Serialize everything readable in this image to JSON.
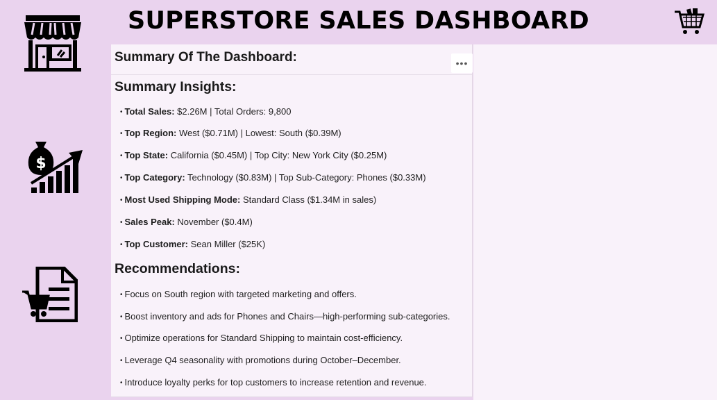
{
  "header": {
    "title": "SUPERSTORE SALES DASHBOARD"
  },
  "icons": {
    "store": "store-icon",
    "cart_top": "shopping-cart-icon",
    "money_growth": "money-growth-icon",
    "order_cart": "order-list-cart-icon"
  },
  "card": {
    "title": "Summary Of The Dashboard:",
    "more_label": "•••",
    "insights_title": "Summary Insights:",
    "insights": [
      {
        "label": "Total Sales:",
        "text": " $2.26M | Total Orders: 9,800"
      },
      {
        "label": "Top Region:",
        "text": " West ($0.71M) | Lowest: South ($0.39M)"
      },
      {
        "label": "Top State:",
        "text": " California ($0.45M) | Top City: New York City ($0.25M)"
      },
      {
        "label": "Top Category:",
        "text": " Technology ($0.83M) | Top Sub-Category: Phones ($0.33M)"
      },
      {
        "label": "Most Used Shipping Mode:",
        "text": " Standard Class ($1.34M in sales)"
      },
      {
        "label": "Sales Peak:",
        "text": " November ($0.4M)"
      },
      {
        "label": "Top Customer:",
        "text": " Sean Miller ($25K)"
      }
    ],
    "recommendations_title": "Recommendations:",
    "recommendations": [
      "Focus on South region with targeted marketing and offers.",
      "Boost inventory and ads for Phones and Chairs—high-performing sub-categories.",
      "Optimize operations for Standard Shipping to maintain cost-efficiency.",
      "Leverage Q4 seasonality with promotions during October–December.",
      "Introduce loyalty perks for top customers to increase retention and revenue."
    ]
  },
  "colors": {
    "background": "#ead3ee",
    "card": "#f9f2fa",
    "text": "#1a1a1a"
  }
}
